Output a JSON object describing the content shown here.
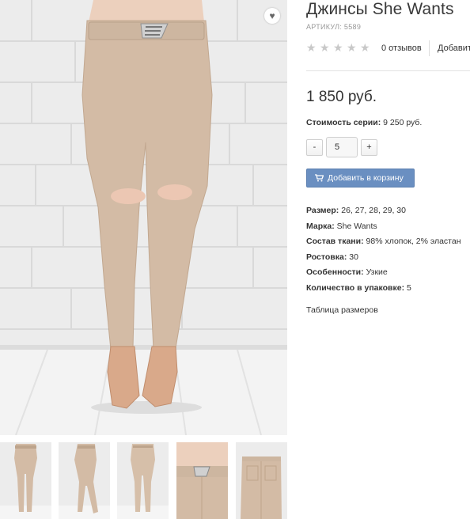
{
  "product": {
    "title": "Джинсы She Wants",
    "sku": "АРТИКУЛ: 5589",
    "reviews_label": "0 отзывов",
    "add_review_label": "Добавит",
    "price": "1 850 руб.",
    "series_label": "Стоимость серии:",
    "series_value": "9 250 руб.",
    "qty_minus": "-",
    "qty_value": "5",
    "qty_plus": "+",
    "add_to_cart": "Добавить в корзину",
    "size_table_link": "Таблица размеров",
    "rating": {
      "value": 0,
      "max": 5
    }
  },
  "props": [
    {
      "label": "Размер:",
      "value": "26, 27, 28, 29, 30"
    },
    {
      "label": "Марка:",
      "value": "She Wants"
    },
    {
      "label": "Состав ткани:",
      "value": "98% хлопок, 2% эластан"
    },
    {
      "label": "Ростовка:",
      "value": "30"
    },
    {
      "label": "Особенности:",
      "value": "Узкие"
    },
    {
      "label": "Количество в упаковке:",
      "value": "5"
    }
  ],
  "icons": {
    "favorite": "heart-icon",
    "cart": "shopping-cart-icon",
    "star": "star-icon"
  },
  "colors": {
    "accent_button": "#6a8fc1",
    "jeans": "#d3bba5",
    "star_inactive": "#c8c8c8"
  },
  "gallery": {
    "thumbnail_count": 5
  }
}
